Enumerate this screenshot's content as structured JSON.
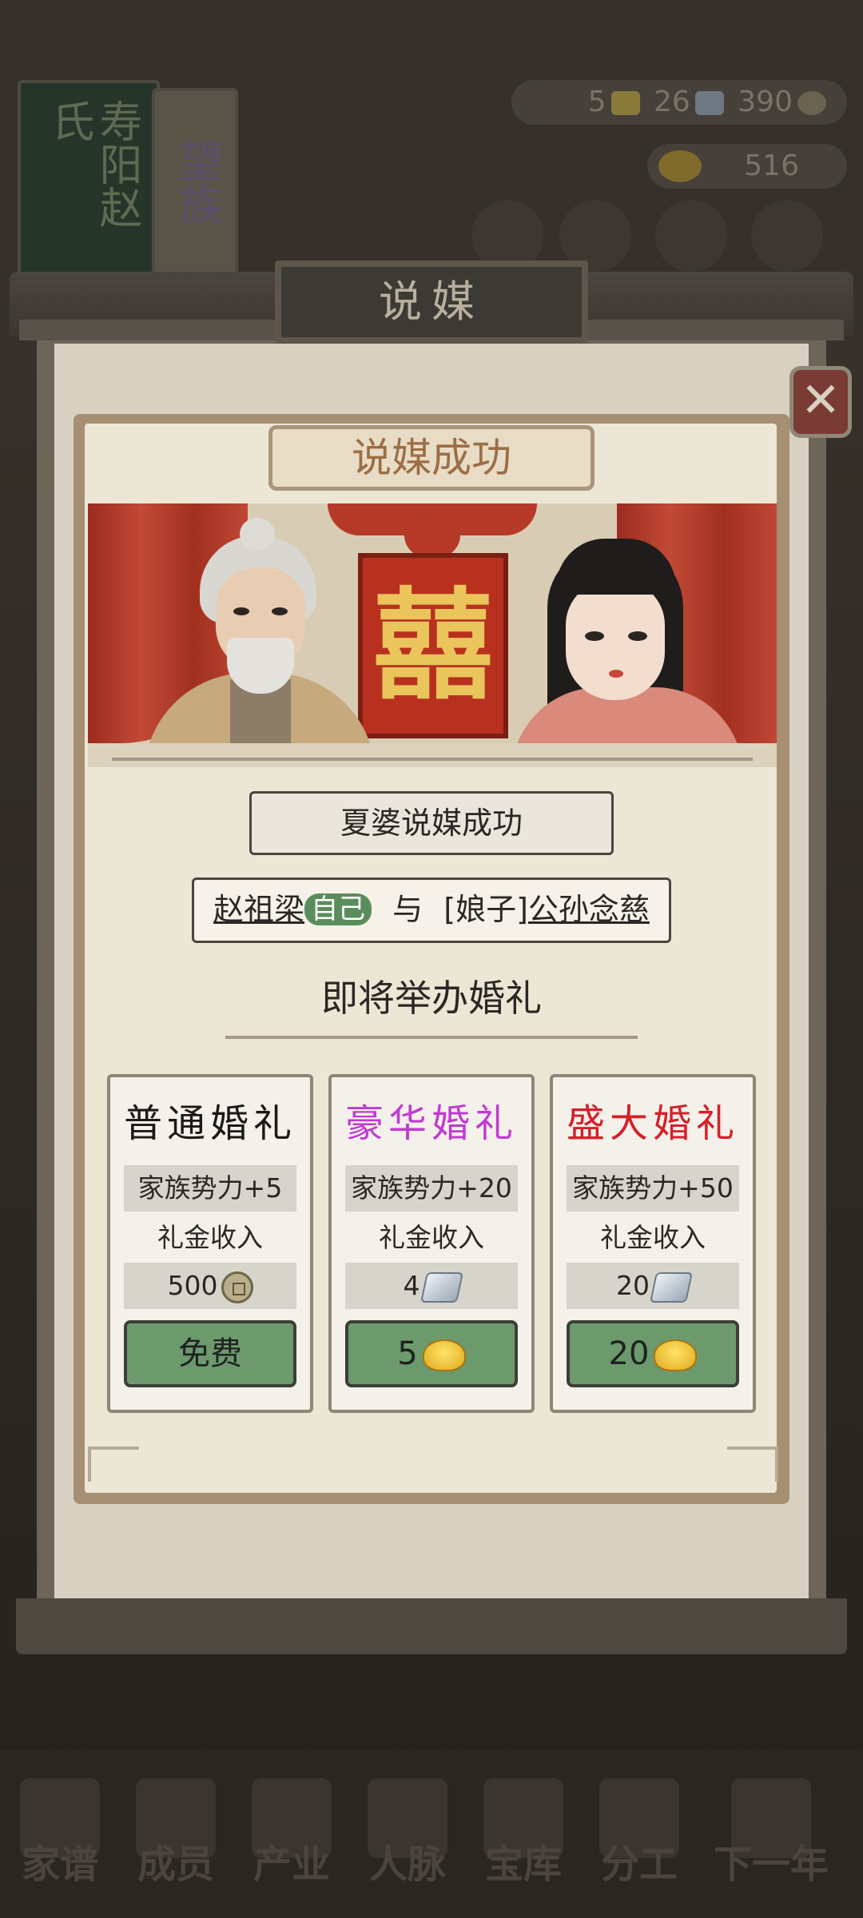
{
  "window_title": "说媒",
  "background": {
    "book1_text": "寿阳赵氏",
    "book2_text": "望族",
    "resources": {
      "item1": "5",
      "item2": "26",
      "item3": "390",
      "gold": "516"
    },
    "nav": [
      "家谱",
      "成员",
      "产业",
      "人脉",
      "宝库",
      "分工",
      "下一年"
    ]
  },
  "dialog": {
    "banner": "说媒成功",
    "xi_char": "囍",
    "match_text": "夏婆说媒成功",
    "groom": "赵祖梁",
    "self_tag": "自己",
    "connector": "与",
    "bride_title": "[娘子]",
    "bride": "公孙念慈",
    "upcoming": "即将举办婚礼",
    "options": [
      {
        "title": "普通婚礼",
        "title_color": "#1c1a18",
        "influence": "家族势力+5",
        "income_label": "礼金收入",
        "income_value": "500",
        "income_icon": "copper-coin-icon",
        "cost": "免费",
        "cost_icon": ""
      },
      {
        "title": "豪华婚礼",
        "title_color": "#c13ad2",
        "influence": "家族势力+20",
        "income_label": "礼金收入",
        "income_value": "4",
        "income_icon": "silver-ingot-icon",
        "cost": "5",
        "cost_icon": "gold-ingot-icon"
      },
      {
        "title": "盛大婚礼",
        "title_color": "#d4202a",
        "influence": "家族势力+50",
        "income_label": "礼金收入",
        "income_value": "20",
        "income_icon": "silver-ingot-icon",
        "cost": "20",
        "cost_icon": "gold-ingot-icon"
      }
    ]
  },
  "colors": {
    "accent_green": "#6d9a6d",
    "banner_text": "#9b6e45",
    "curtain_red": "#b53a28"
  }
}
